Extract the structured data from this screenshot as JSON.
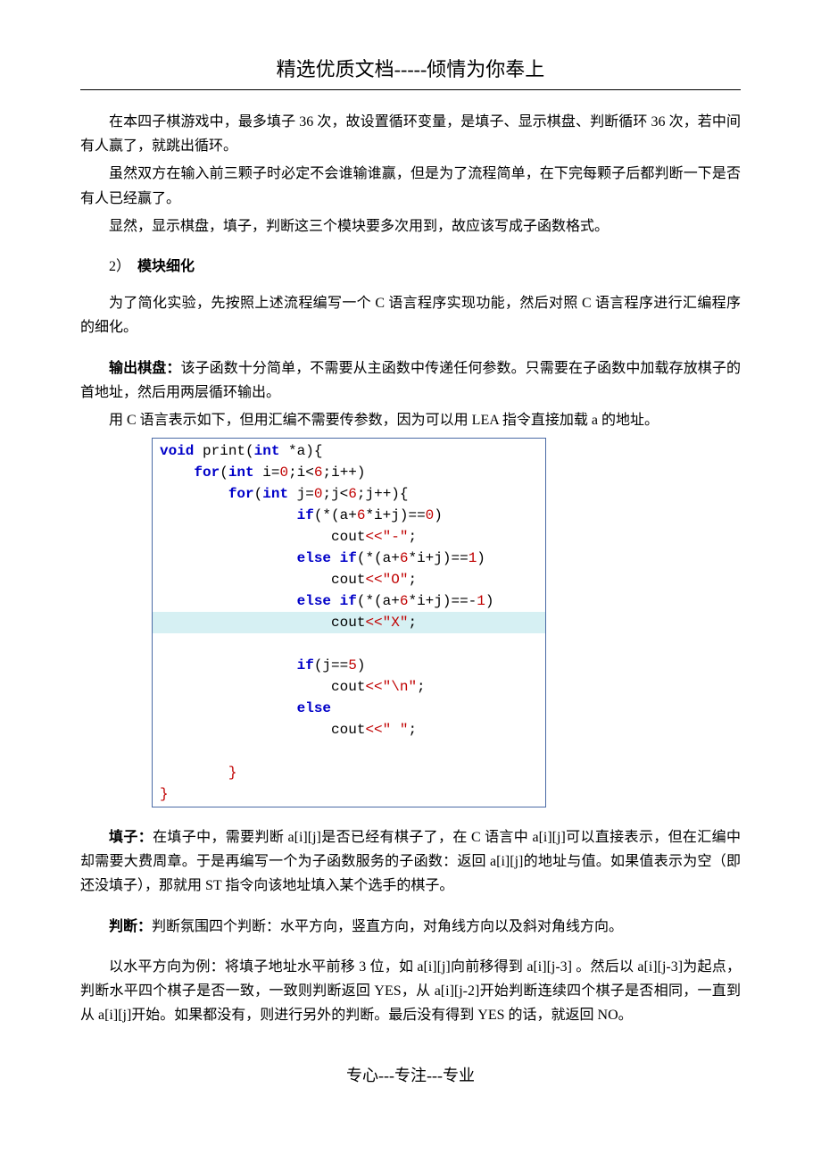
{
  "header": {
    "title": "精选优质文档-----倾情为你奉上"
  },
  "para1": "在本四子棋游戏中，最多填子 36 次，故设置循环变量，是填子、显示棋盘、判断循环 36 次，若中间有人赢了，就跳出循环。",
  "para2": "虽然双方在输入前三颗子时必定不会谁输谁赢，但是为了流程简单，在下完每颗子后都判断一下是否有人已经赢了。",
  "para3": "显然，显示棋盘，填子，判断这三个模块要多次用到，故应该写成子函数格式。",
  "section": {
    "num": "2）",
    "title": "模块细化"
  },
  "para4": "为了简化实验，先按照上述流程编写一个 C 语言程序实现功能，然后对照 C 语言程序进行汇编程序的细化。",
  "board_label": "输出棋盘：",
  "para5": "该子函数十分简单，不需要从主函数中传递任何参数。只需要在子函数中加载存放棋子的首地址，然后用两层循环输出。",
  "para6": "用 C 语言表示如下，但用汇编不需要传参数，因为可以用 LEA 指令直接加载 a 的地址。",
  "code": {
    "l1a": "void",
    "l1b": " print(",
    "l1c": "int",
    "l1d": " *a){",
    "l2a": "    ",
    "l2b": "for",
    "l2c": "(",
    "l2d": "int",
    "l2e": " i=",
    "l2f": "0",
    "l2g": ";i<",
    "l2h": "6",
    "l2i": ";i++)",
    "l3a": "        ",
    "l3b": "for",
    "l3c": "(",
    "l3d": "int",
    "l3e": " j=",
    "l3f": "0",
    "l3g": ";j<",
    "l3h": "6",
    "l3i": ";j++){",
    "l4a": "                ",
    "l4b": "if",
    "l4c": "(*(a+",
    "l4d": "6",
    "l4e": "*i+j)==",
    "l4f": "0",
    "l4g": ")",
    "l5a": "                    cout",
    "l5b": "<<",
    "l5c": "\"-\"",
    "l5d": ";",
    "l6a": "                ",
    "l6b": "else if",
    "l6c": "(*(a+",
    "l6d": "6",
    "l6e": "*i+j)==",
    "l6f": "1",
    "l6g": ")",
    "l7a": "                    cout",
    "l7b": "<<",
    "l7c": "\"O\"",
    "l7d": ";",
    "l8a": "                ",
    "l8b": "else if",
    "l8c": "(*(a+",
    "l8d": "6",
    "l8e": "*i+j)==-",
    "l8f": "1",
    "l8g": ")",
    "l9a": "                    cout",
    "l9b": "<<",
    "l9c": "\"X\"",
    "l9d": ";",
    "l10": "",
    "l11a": "                ",
    "l11b": "if",
    "l11c": "(j==",
    "l11d": "5",
    "l11e": ")",
    "l12a": "                    cout",
    "l12b": "<<",
    "l12c": "\"\\n\"",
    "l12d": ";",
    "l13a": "                ",
    "l13b": "else",
    "l14a": "                    cout",
    "l14b": "<<",
    "l14c": "\" \"",
    "l14d": ";",
    "l15": "",
    "l16": "        }",
    "l17": "}"
  },
  "fill_label": "填子：",
  "para7": "在填子中，需要判断 a[i][j]是否已经有棋子了，在 C 语言中 a[i][j]可以直接表示，但在汇编中却需要大费周章。于是再编写一个为子函数服务的子函数：返回 a[i][j]的地址与值。如果值表示为空（即还没填子），那就用 ST 指令向该地址填入某个选手的棋子。",
  "judge_label": "判断：",
  "para8": "判断氛围四个判断：水平方向，竖直方向，对角线方向以及斜对角线方向。",
  "para9": "以水平方向为例：将填子地址水平前移 3 位，如 a[i][j]向前移得到 a[i][j-3] 。然后以 a[i][j-3]为起点，判断水平四个棋子是否一致，一致则判断返回 YES，从 a[i][j-2]开始判断连续四个棋子是否相同，一直到从 a[i][j]开始。如果都没有，则进行另外的判断。最后没有得到 YES 的话，就返回 NO。",
  "footer": "专心---专注---专业"
}
